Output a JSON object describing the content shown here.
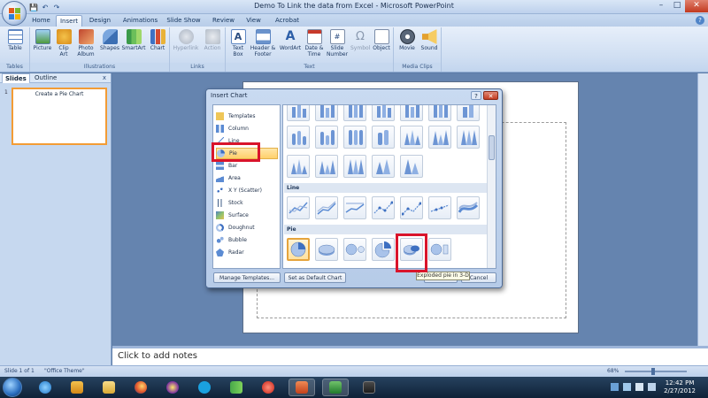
{
  "window": {
    "title": "Demo To Link the data from Excel - Microsoft PowerPoint",
    "controls": {
      "minimize": "–",
      "maximize": "□",
      "close": "✕"
    }
  },
  "qat": {
    "save": "💾",
    "undo": "↶",
    "redo": "↷"
  },
  "tabs": [
    "Home",
    "Insert",
    "Design",
    "Animations",
    "Slide Show",
    "Review",
    "View",
    "Acrobat"
  ],
  "active_tab": "Insert",
  "ribbon": {
    "groups": [
      {
        "label": "Tables",
        "buttons": [
          "Table"
        ]
      },
      {
        "label": "Illustrations",
        "buttons": [
          "Picture",
          "Clip Art",
          "Photo Album",
          "Shapes",
          "SmartArt",
          "Chart"
        ]
      },
      {
        "label": "Links",
        "buttons": [
          "Hyperlink",
          "Action"
        ]
      },
      {
        "label": "Text",
        "buttons": [
          "Text Box",
          "Header & Footer",
          "WordArt",
          "Date & Time",
          "Slide Number",
          "Symbol",
          "Object"
        ]
      },
      {
        "label": "Media Clips",
        "buttons": [
          "Movie",
          "Sound"
        ]
      }
    ]
  },
  "left_pane": {
    "tabs": [
      "Slides",
      "Outline"
    ],
    "close": "x",
    "slide_number": "1",
    "thumb_title": "Create a Pie Chart"
  },
  "slide": {
    "title": "Create a Pie Chart"
  },
  "notes": {
    "placeholder": "Click to add notes"
  },
  "status": {
    "slide": "Slide 1 of 1",
    "theme": "\"Office Theme\"",
    "zoom": "68%",
    "zoom_fraction": 0.45
  },
  "dialog": {
    "title": "Insert Chart",
    "help": "?",
    "close": "✕",
    "categories": [
      "Templates",
      "Column",
      "Line",
      "Pie",
      "Bar",
      "Area",
      "X Y (Scatter)",
      "Stock",
      "Surface",
      "Doughnut",
      "Bubble",
      "Radar"
    ],
    "selected_category": "Pie",
    "sections": [
      "Line",
      "Pie"
    ],
    "buttons": {
      "manage": "Manage Templates...",
      "default": "Set as Default Chart",
      "ok": "OK",
      "cancel": "Cancel"
    },
    "tooltip": "Exploded pie in 3-D"
  },
  "taskbar": {
    "clock_time": "12:42 PM",
    "clock_date": "2/27/2012"
  },
  "colors": {
    "highlight": "#d9142b",
    "accent": "#f39c35",
    "ribbon_bg": "#cfdef2"
  }
}
